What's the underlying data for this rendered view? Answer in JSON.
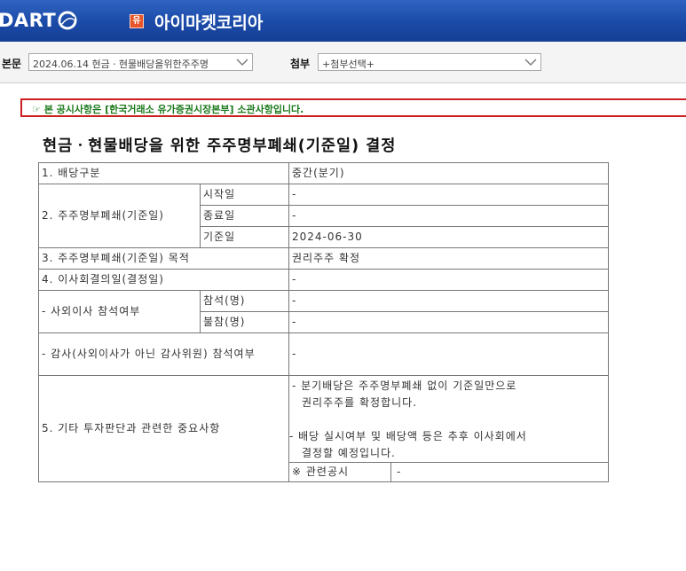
{
  "header": {
    "logo_text": "DART",
    "market_badge": "유",
    "company_name": "아이마켓코리아"
  },
  "toolbar": {
    "body_label": "본문",
    "body_select_value": "2024.06.14  현금ㆍ현물배당을위한주주명",
    "attach_label": "첨부",
    "attach_select_value": "+첨부선택+"
  },
  "notice": "☞ 본 공시사항은 [한국거래소 유가증권시장본부] 소관사항입니다.",
  "doc_title": "현금ㆍ현물배당을 위한 주주명부폐쇄(기준일) 결정",
  "table": {
    "r1_label": "1. 배당구분",
    "r1_value": "중간(분기)",
    "r2_label": "2. 주주명부폐쇄(기준일)",
    "r2_start_label": "시작일",
    "r2_start_value": "-",
    "r2_end_label": "종료일",
    "r2_end_value": "-",
    "r2_record_label": "기준일",
    "r2_record_value": "2024-06-30",
    "r3_label": "3. 주주명부폐쇄(기준일) 목적",
    "r3_value": "권리주주 확정",
    "r4_label": "4. 이사회결의일(결정일)",
    "r4_value": "-",
    "r5_label": "- 사외이사 참석여부",
    "r5_present_label": "참석(명)",
    "r5_present_value": "-",
    "r5_absent_label": "불참(명)",
    "r5_absent_value": "-",
    "r6_label": "- 감사(사외이사가 아닌 감사위원) 참석여부",
    "r6_value": "-",
    "r7_label": "5. 기타 투자판단과 관련한 중요사항",
    "r7_line1": "- 분기배당은 주주명부폐쇄 없이 기준일만으로",
    "r7_line2": "권리주주를 확정합니다.",
    "r7_line3": "- 배당 실시여부 및 배당액 등은 추후 이사회에서",
    "r7_line4": "결정할 예정입니다.",
    "related_label": "※ 관련공시",
    "related_value": "-"
  },
  "colors": {
    "header_bg": "#1b4aa7",
    "notice_border": "#cc2020",
    "notice_text": "#1b7a1b",
    "badge": "#e8552a"
  }
}
